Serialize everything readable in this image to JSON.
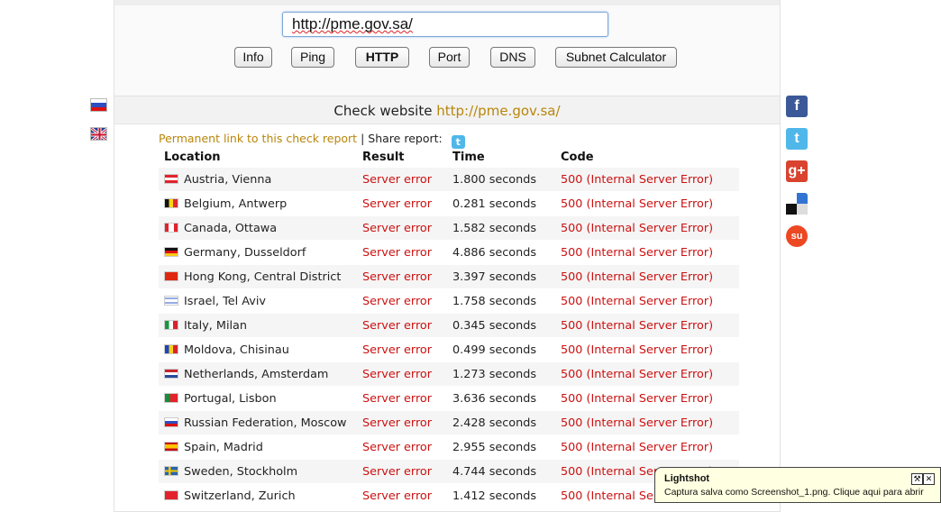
{
  "search": {
    "url_value": "http://pme.gov.sa/"
  },
  "tools": [
    {
      "label": "Info",
      "active": false
    },
    {
      "label": "Ping",
      "active": false
    },
    {
      "label": "HTTP",
      "active": true
    },
    {
      "label": "Port",
      "active": false
    },
    {
      "label": "DNS",
      "active": false
    },
    {
      "label": "Subnet Calculator",
      "active": false
    }
  ],
  "report": {
    "heading_prefix": "Check website",
    "heading_link": "http://pme.gov.sa/",
    "permalink_label": "Permanent link to this check report",
    "separator": "|",
    "share_label": "Share report:",
    "columns": [
      "Location",
      "Result",
      "Time",
      "Code"
    ],
    "rows": [
      {
        "location": "Austria, Vienna",
        "flag": "austria",
        "result": "Server error",
        "time": "1.800 seconds",
        "code": "500 (Internal Server Error)"
      },
      {
        "location": "Belgium, Antwerp",
        "flag": "belgium",
        "result": "Server error",
        "time": "0.281 seconds",
        "code": "500 (Internal Server Error)"
      },
      {
        "location": "Canada, Ottawa",
        "flag": "canada",
        "result": "Server error",
        "time": "1.582 seconds",
        "code": "500 (Internal Server Error)"
      },
      {
        "location": "Germany, Dusseldorf",
        "flag": "germany",
        "result": "Server error",
        "time": "4.886 seconds",
        "code": "500 (Internal Server Error)"
      },
      {
        "location": "Hong Kong, Central District",
        "flag": "hongkong",
        "result": "Server error",
        "time": "3.397 seconds",
        "code": "500 (Internal Server Error)"
      },
      {
        "location": "Israel, Tel Aviv",
        "flag": "israel",
        "result": "Server error",
        "time": "1.758 seconds",
        "code": "500 (Internal Server Error)"
      },
      {
        "location": "Italy, Milan",
        "flag": "italy",
        "result": "Server error",
        "time": "0.345 seconds",
        "code": "500 (Internal Server Error)"
      },
      {
        "location": "Moldova, Chisinau",
        "flag": "moldova",
        "result": "Server error",
        "time": "0.499 seconds",
        "code": "500 (Internal Server Error)"
      },
      {
        "location": "Netherlands, Amsterdam",
        "flag": "netherlands",
        "result": "Server error",
        "time": "1.273 seconds",
        "code": "500 (Internal Server Error)"
      },
      {
        "location": "Portugal, Lisbon",
        "flag": "portugal",
        "result": "Server error",
        "time": "3.636 seconds",
        "code": "500 (Internal Server Error)"
      },
      {
        "location": "Russian Federation, Moscow",
        "flag": "russia",
        "result": "Server error",
        "time": "2.428 seconds",
        "code": "500 (Internal Server Error)"
      },
      {
        "location": "Spain, Madrid",
        "flag": "spain",
        "result": "Server error",
        "time": "2.955 seconds",
        "code": "500 (Internal Server Error)"
      },
      {
        "location": "Sweden, Stockholm",
        "flag": "sweden",
        "result": "Server error",
        "time": "4.744 seconds",
        "code": "500 (Internal Server Error)"
      },
      {
        "location": "Switzerland, Zurich",
        "flag": "switzerland",
        "result": "Server error",
        "time": "1.412 seconds",
        "code": "500 (Internal Server Error)"
      }
    ]
  },
  "languages": [
    "russian-flag-icon",
    "english-flag-icon"
  ],
  "social": [
    {
      "icon": "facebook-icon",
      "glyph": "f",
      "color": "#3b5998"
    },
    {
      "icon": "twitter-icon",
      "glyph": "t",
      "color": "#4fb7ea"
    },
    {
      "icon": "google-plus-icon",
      "glyph": "g+",
      "color": "#d9432f"
    },
    {
      "icon": "delicious-icon",
      "glyph": "",
      "color": "#3274d1"
    },
    {
      "icon": "stumbleupon-icon",
      "glyph": "su",
      "color": "#eb4823"
    }
  ],
  "colors": {
    "link": "#b8860b",
    "error": "#cc1111",
    "accent_border": "#7fa6d6"
  },
  "lightshot": {
    "title": "Lightshot",
    "message": "Captura salva como Screenshot_1.png. Clique aqui para abrir"
  }
}
